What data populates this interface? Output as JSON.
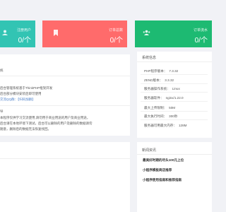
{
  "stats": [
    {
      "label": "注册用户",
      "value": "0/个",
      "icon": "users-icon",
      "color": "#32c4b3"
    },
    {
      "label": "订单总数",
      "value": "0/个",
      "icon": "bookmark-icon",
      "color": "#ff6b6b"
    },
    {
      "label": "订单流水",
      "value": "0/个",
      "icon": "group-icon",
      "color": "#1dba72"
    }
  ],
  "left_panel": {
    "line1": "统",
    "line2": "后台管理系统基于ThinkPHP框架开发",
    "line3": "后台部分模块安装后即可使用",
    "line4": "交流QQ群：【扫码加群】",
    "line5": "导",
    "line6": "本程序仅供学习交流使用,请勿用于商业用途的用户及商业用途，",
    "line7": "后台请在本地环境下测试，后台可以删除的用户及删除的数据请勿",
    "line8": "随意，删除后的数据无法恢复找回。"
  },
  "system": {
    "title": "系统信息",
    "rows": [
      {
        "label": "PHP程序版本：",
        "value": "7.3.32"
      },
      {
        "label": "ZEND版本：",
        "value": "3.3.32"
      },
      {
        "label": "服务器操作系统：",
        "value": "Linux"
      },
      {
        "label": "服务器软件：",
        "value": "nginx/1.22.0"
      },
      {
        "label": "最大上传限制：",
        "value": "50M"
      },
      {
        "label": "最大执行时间：",
        "value": "300秒"
      },
      {
        "label": "服务器可用最大内存：",
        "value": "128M"
      }
    ]
  },
  "news": {
    "title": "新闻资讯",
    "items": [
      "最美好时期的尽头100元上位",
      "小程序模板商店推荐",
      "小程序使用指南和推荐指南"
    ]
  }
}
